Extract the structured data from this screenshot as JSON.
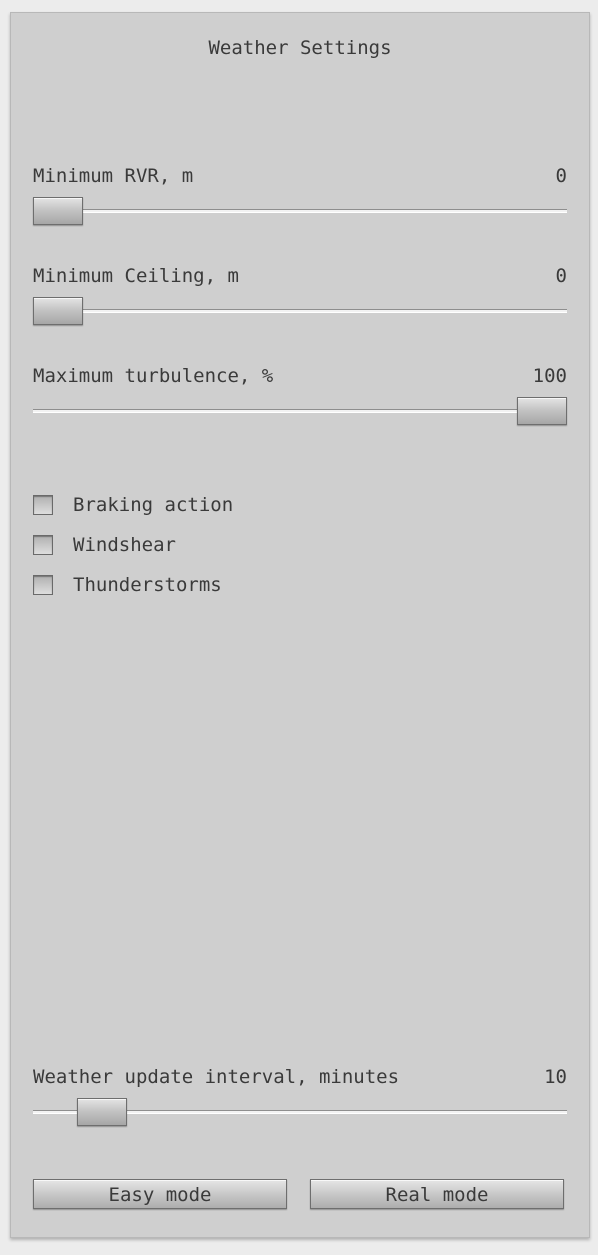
{
  "window": {
    "title": "Weather Settings"
  },
  "sliders": {
    "min_rvr": {
      "label": "Minimum RVR, m",
      "value": "0",
      "fraction": 0.0
    },
    "min_ceiling": {
      "label": "Minimum Ceiling, m",
      "value": "0",
      "fraction": 0.0
    },
    "max_turbulence": {
      "label": "Maximum turbulence, %",
      "value": "100",
      "fraction": 1.0
    },
    "update_interval": {
      "label": "Weather update interval, minutes",
      "value": "10",
      "fraction": 0.09
    }
  },
  "checkboxes": [
    {
      "label": "Braking action",
      "checked": false
    },
    {
      "label": "Windshear",
      "checked": false
    },
    {
      "label": "Thunderstorms",
      "checked": false
    }
  ],
  "buttons": {
    "easy_mode": "Easy mode",
    "real_mode": "Real mode"
  }
}
